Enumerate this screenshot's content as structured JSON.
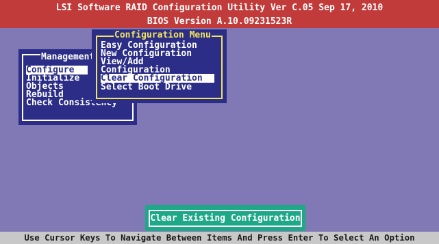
{
  "header": {
    "title": "LSI Software RAID Configuration Utility Ver C.05 Sep 17, 2010",
    "bios_version": "BIOS Version   A.10.09231523R"
  },
  "management_menu": {
    "title": "Management",
    "items": [
      {
        "label": "Configure",
        "selected": true
      },
      {
        "label": "Initialize",
        "selected": false
      },
      {
        "label": "Objects",
        "selected": false
      },
      {
        "label": "Rebuild",
        "selected": false
      },
      {
        "label": "Check Consistency",
        "selected": false
      }
    ]
  },
  "configuration_menu": {
    "title": "Configuration Menu",
    "items": [
      {
        "label": "Easy Configuration",
        "selected": false
      },
      {
        "label": "New Configuration",
        "selected": false
      },
      {
        "label": "View/Add",
        "selected": false
      },
      {
        "label": "Configuration",
        "selected": false
      },
      {
        "label": "Clear Configuration",
        "selected": true
      },
      {
        "label": "Select Boot Drive",
        "selected": false
      }
    ]
  },
  "status_box": {
    "text": "Clear Existing Configuration"
  },
  "footer": {
    "hint": "Use Cursor Keys To Navigate Between Items And Press Enter To Select An Option"
  },
  "colors": {
    "background": "#8179b5",
    "header": "#c23b3b",
    "window": "#2b2d86",
    "config_border": "#f2e45c",
    "status": "#1ea887",
    "footer": "#c8c8c8"
  }
}
